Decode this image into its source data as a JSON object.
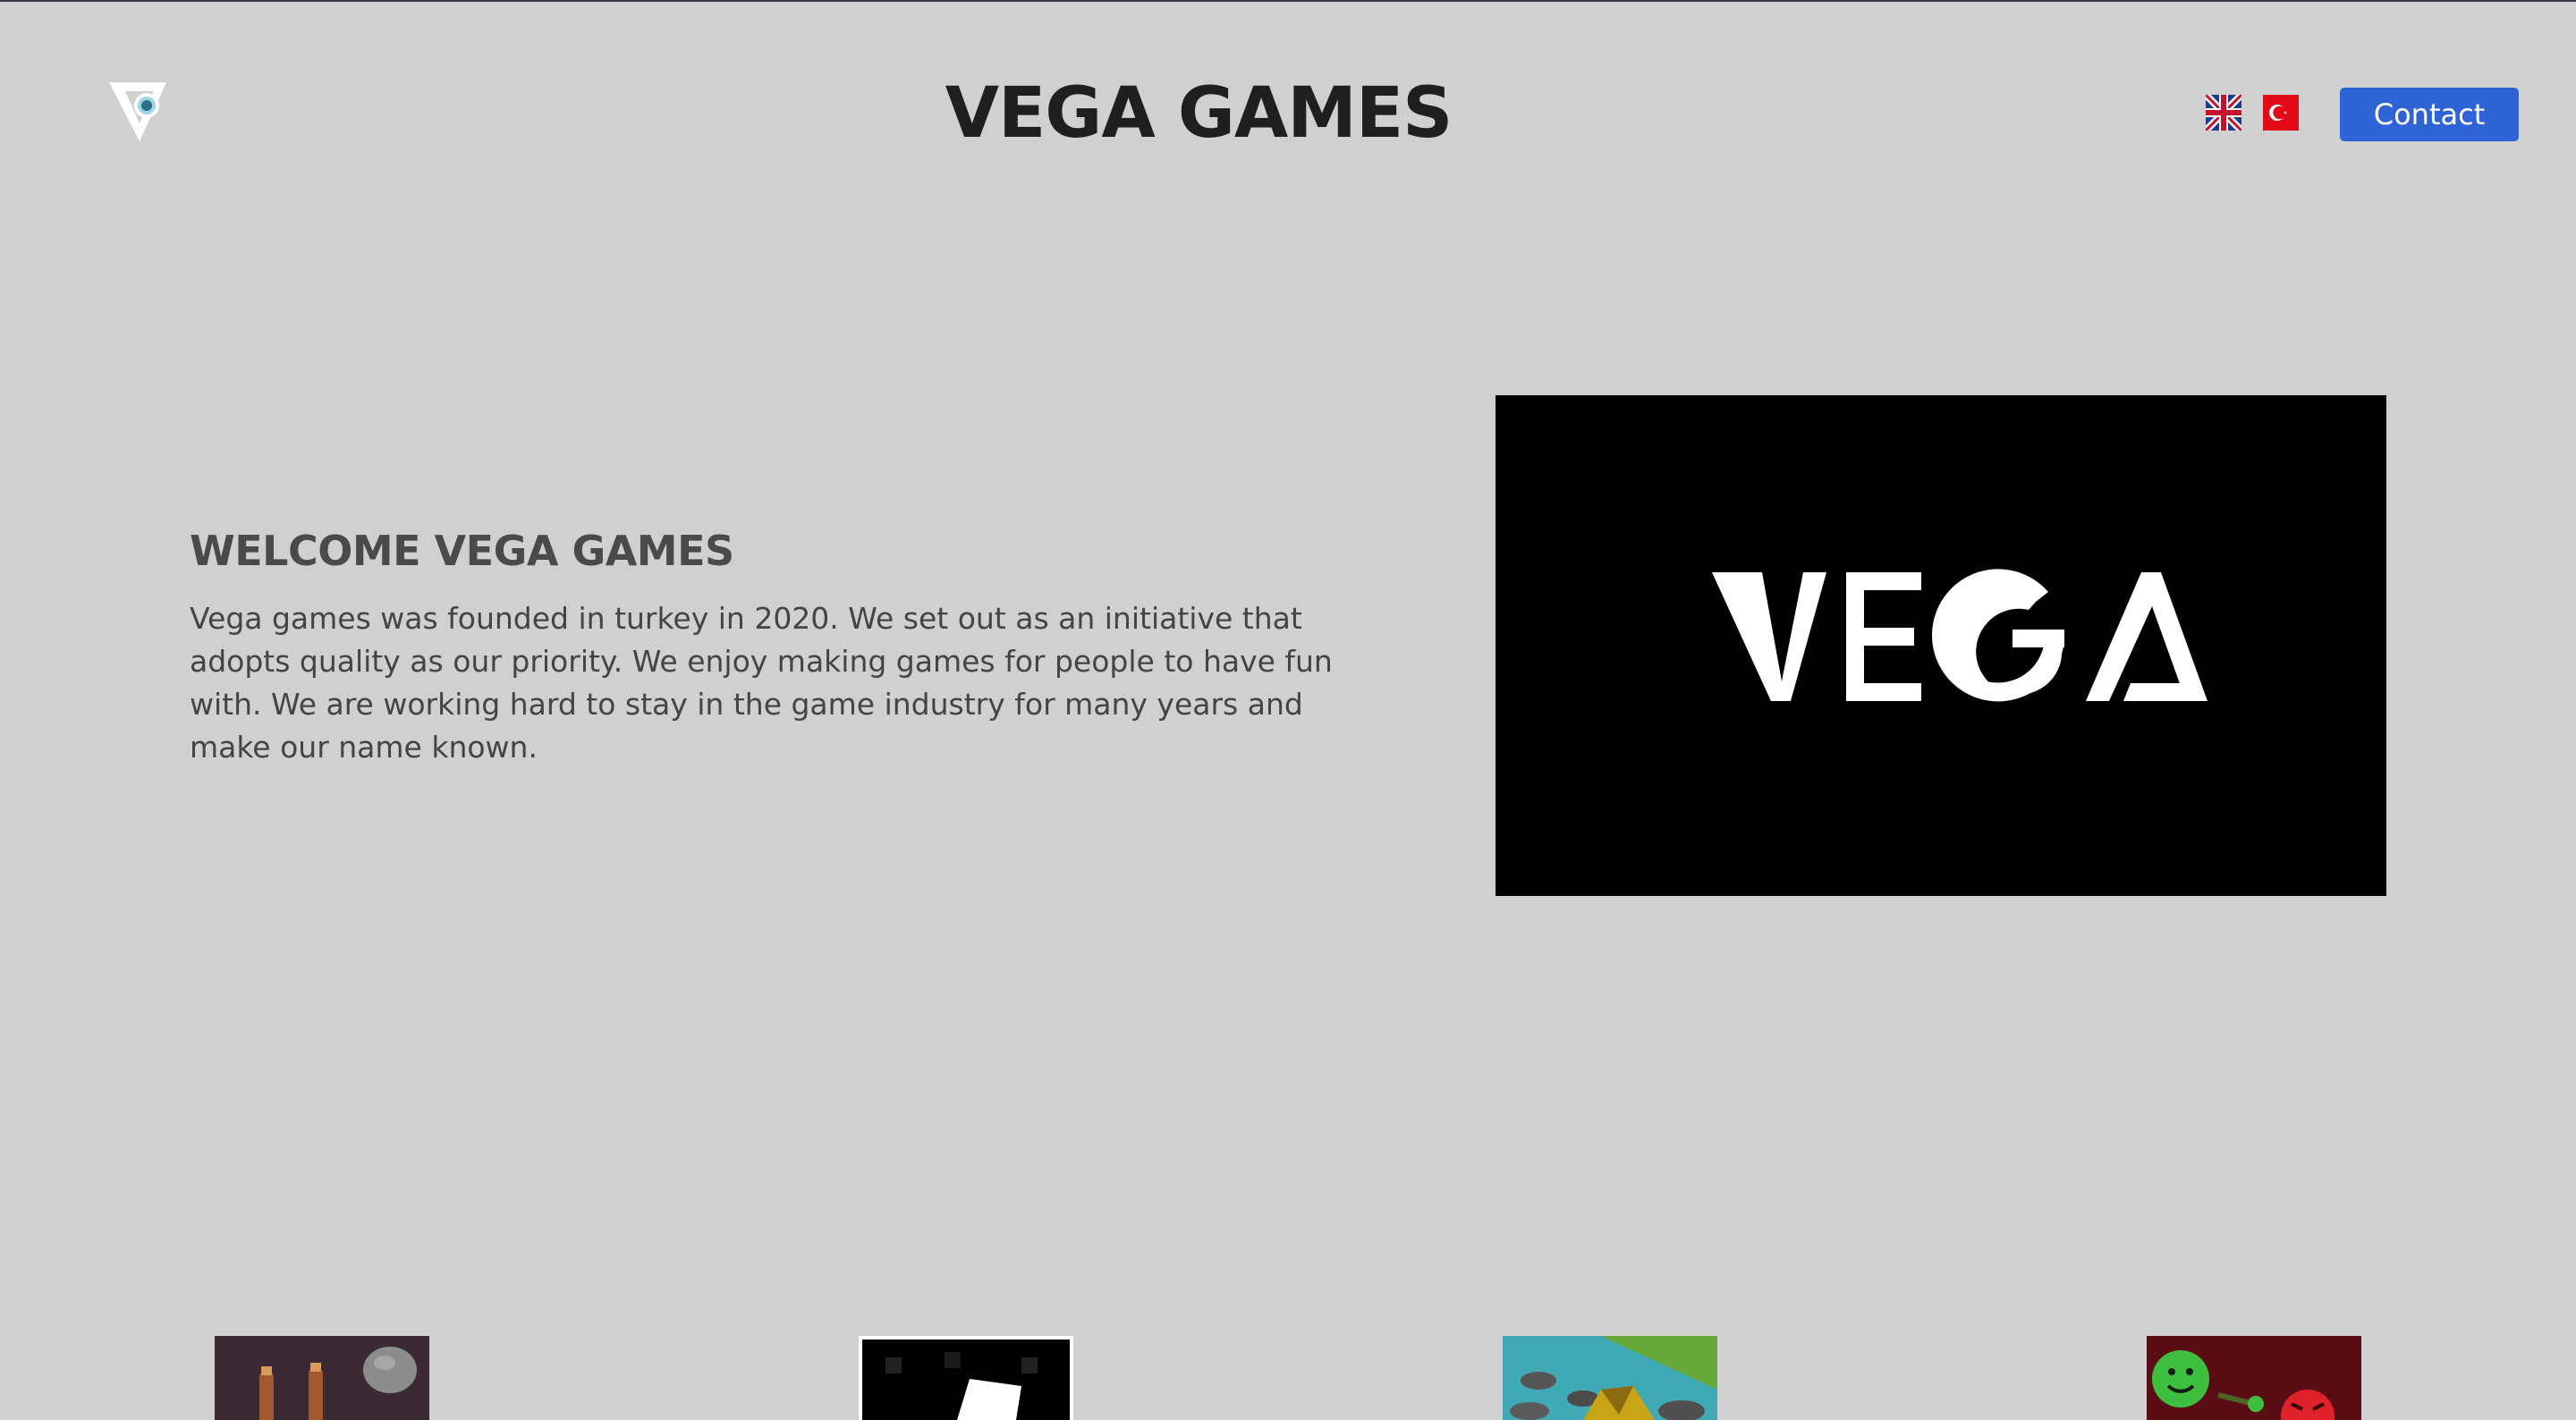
{
  "header": {
    "logo_icon": "vega-logo-icon",
    "title": "VEGA GAMES",
    "languages": [
      {
        "code": "en",
        "icon": "uk-flag-icon"
      },
      {
        "code": "tr",
        "icon": "turkey-flag-icon"
      }
    ],
    "contact_label": "Contact"
  },
  "welcome": {
    "heading": "WELCOME VEGA GAMES",
    "body": "Vega games was founded in turkey in 2020. We set out as an initiative that adopts quality as our priority. We enjoy making games for people to have fun with. We are working hard to stay in the game industry for many years and make our name known."
  },
  "hero": {
    "image_text": "VEGA"
  },
  "games": [
    {
      "icon": "slingshot-game-icon"
    },
    {
      "icon": "white-cube-game-icon"
    },
    {
      "icon": "river-rocks-game-icon"
    },
    {
      "icon": "smiley-faces-game-icon"
    }
  ],
  "colors": {
    "background": "#d0d0d0",
    "accent": "#2f64d6",
    "title": "#1f1f1f",
    "text": "#444444"
  }
}
